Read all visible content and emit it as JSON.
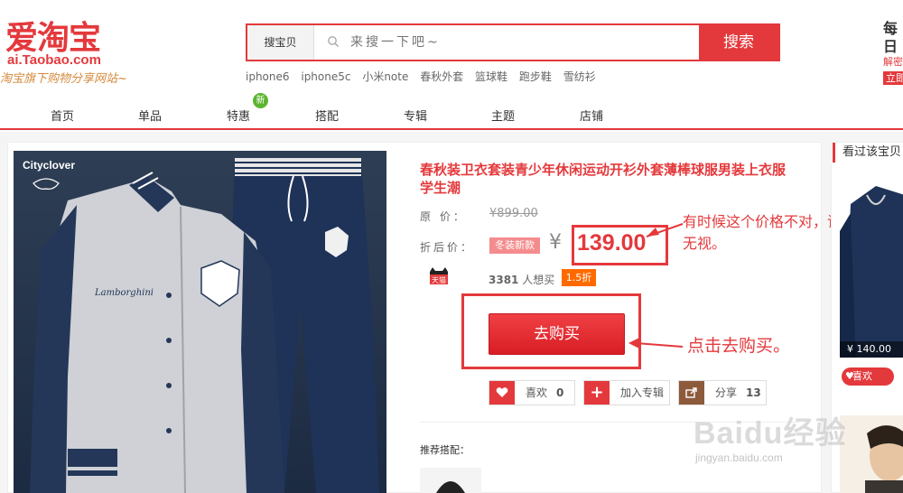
{
  "logo": {
    "main": "爱淘宝",
    "domain": "ai.Taobao.com",
    "slogan": "淘宝旗下购物分享网站~"
  },
  "search": {
    "category": "搜宝贝",
    "placeholder": "来搜一下吧~",
    "button": "搜索",
    "hot_words": [
      "iphone6",
      "iphone5c",
      "小米note",
      "春秋外套",
      "篮球鞋",
      "跑步鞋",
      "雪纺衫"
    ]
  },
  "right_promo": {
    "line1": "每日",
    "line2": "解密",
    "line3": "立即"
  },
  "nav": {
    "items": [
      "首页",
      "单品",
      "特惠",
      "搭配",
      "专辑",
      "主题",
      "店铺"
    ],
    "new_badge": "新"
  },
  "product": {
    "image_brand": "Cityclover",
    "title": "春秋装卫衣套装青少年休闲运动开衫外套薄棒球服男装上衣服学生潮",
    "orig_label": "原 价：",
    "orig_price": "¥899.00",
    "sale_label": "折后价：",
    "sale_tag": "冬装新款",
    "yen": "¥",
    "sale_price": "139.00",
    "store_badge": "天猫",
    "want_count": "3381",
    "want_text": "人想买",
    "discount": "1.5折",
    "buy_button": "去购买",
    "actions": {
      "like_label": "喜欢",
      "like_count": "0",
      "album_label": "加入专辑",
      "share_label": "分享",
      "share_count": "13"
    },
    "recommend_label": "推荐搭配："
  },
  "annotations": {
    "price_note": "有时候这个价格不对，请无视。",
    "buy_note": "点击去购买。"
  },
  "sidebar": {
    "title": "看过该宝贝",
    "item_price": "¥ 140.00",
    "like_label": "喜欢"
  },
  "watermark": {
    "main": "Baidu经验",
    "sub": "jingyan.baidu.com"
  },
  "colors": {
    "accent": "#e4393c",
    "discount": "#ff6a00",
    "new_badge": "#5cb531"
  }
}
